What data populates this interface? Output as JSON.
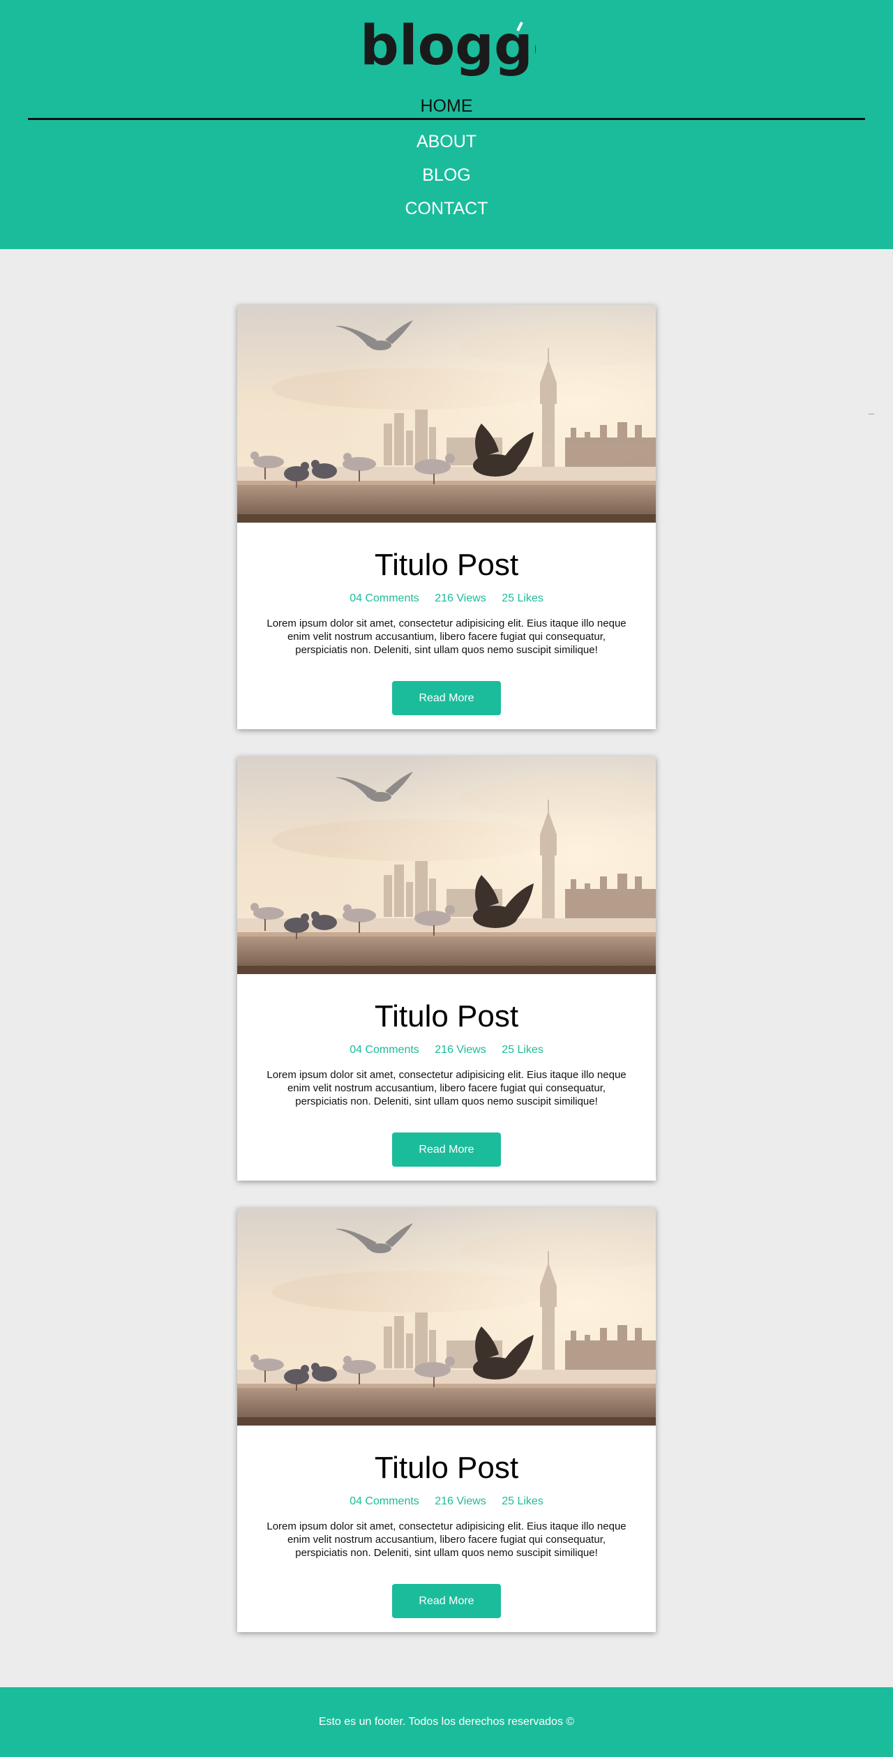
{
  "header": {
    "logo_text": "bloggo",
    "brand_color": "#1bbc9b",
    "nav": [
      {
        "label": "HOME",
        "active": true
      },
      {
        "label": "ABOUT",
        "active": false
      },
      {
        "label": "BLOG",
        "active": false
      },
      {
        "label": "CONTACT",
        "active": false
      }
    ]
  },
  "posts": [
    {
      "image": "pigeons-london-photo",
      "title": "Titulo Post",
      "comments": "04 Comments",
      "views": "216 Views",
      "likes": "25 Likes",
      "excerpt": "Lorem ipsum dolor sit amet, consectetur adipisicing elit. Eius itaque illo neque enim velit nostrum accusantium, libero facere fugiat qui consequatur, perspiciatis non. Deleniti, sint ullam quos nemo suscipit similique!",
      "button_label": "Read More"
    },
    {
      "image": "pigeons-london-photo",
      "title": "Titulo Post",
      "comments": "04 Comments",
      "views": "216 Views",
      "likes": "25 Likes",
      "excerpt": "Lorem ipsum dolor sit amet, consectetur adipisicing elit. Eius itaque illo neque enim velit nostrum accusantium, libero facere fugiat qui consequatur, perspiciatis non. Deleniti, sint ullam quos nemo suscipit similique!",
      "button_label": "Read More"
    },
    {
      "image": "pigeons-london-photo",
      "title": "Titulo Post",
      "comments": "04 Comments",
      "views": "216 Views",
      "likes": "25 Likes",
      "excerpt": "Lorem ipsum dolor sit amet, consectetur adipisicing elit. Eius itaque illo neque enim velit nostrum accusantium, libero facere fugiat qui consequatur, perspiciatis non. Deleniti, sint ullam quos nemo suscipit similique!",
      "button_label": "Read More"
    }
  ],
  "footer": {
    "text": "Esto es un footer. Todos los derechos reservados ©"
  }
}
